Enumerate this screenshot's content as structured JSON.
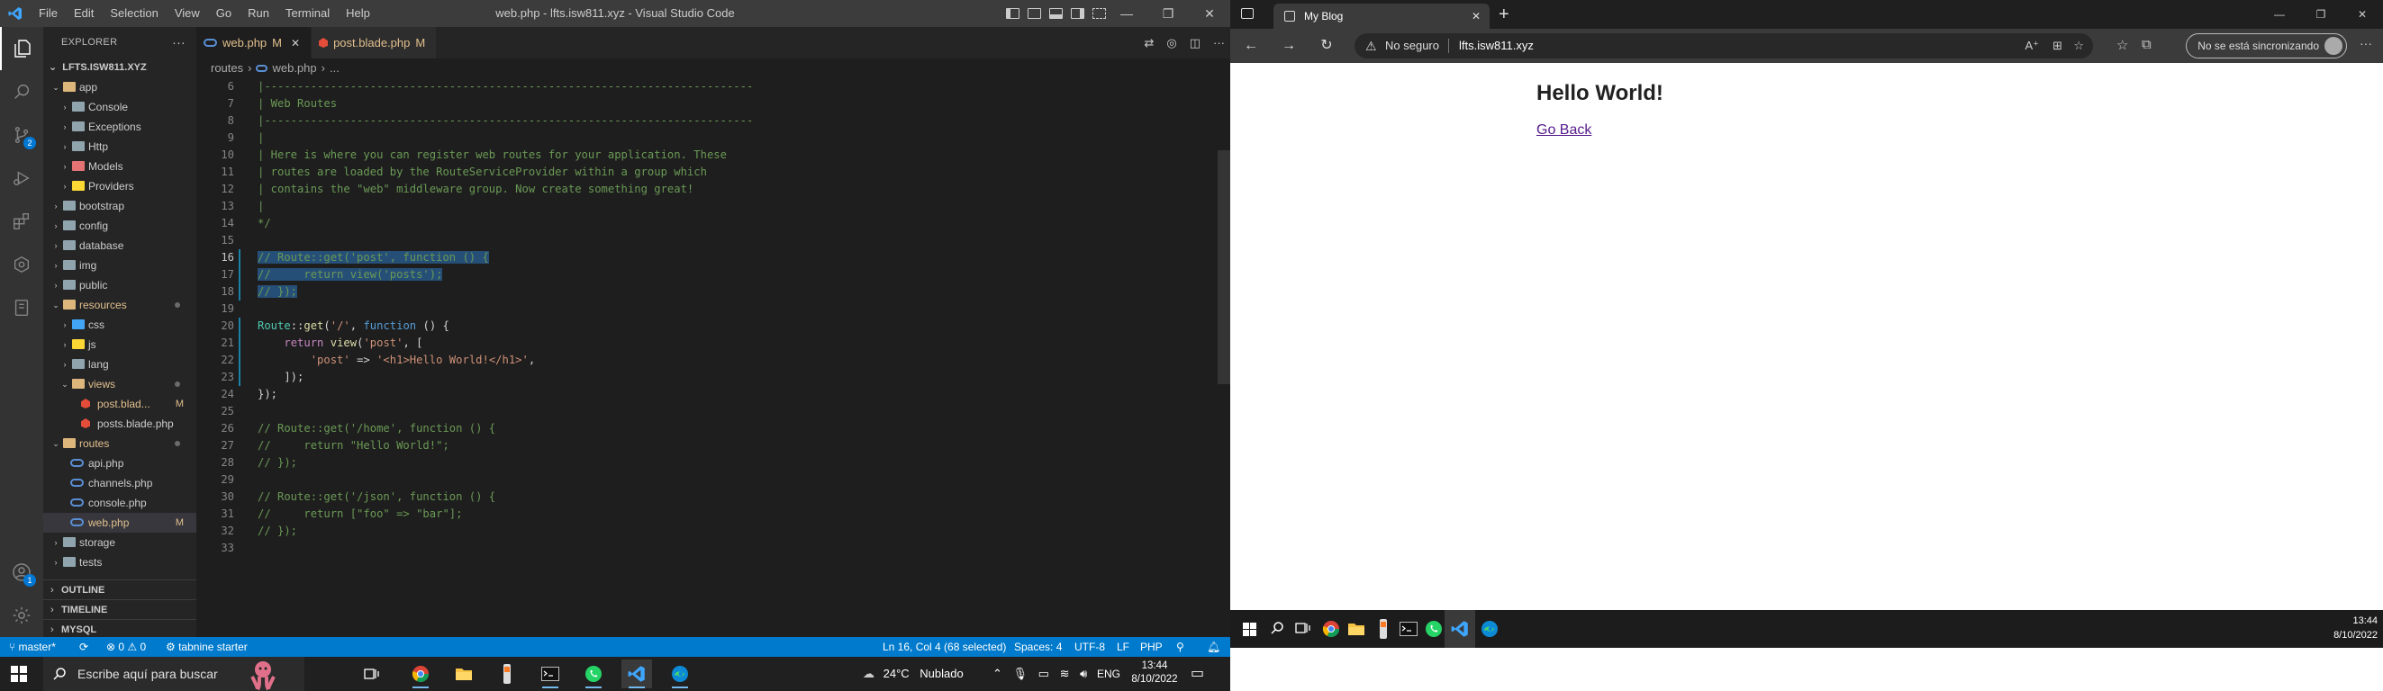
{
  "vscode": {
    "title": "web.php - lfts.isw811.xyz - Visual Studio Code",
    "menu": [
      "File",
      "Edit",
      "Selection",
      "View",
      "Go",
      "Run",
      "Terminal",
      "Help"
    ],
    "explorer_header": "EXPLORER",
    "explorer_root": "LFTS.ISW811.XYZ",
    "source_control_badge": "2",
    "accounts_badge": "1",
    "tree": [
      {
        "label": "app",
        "depth": 0,
        "type": "folder-open",
        "color": "#dcb67a"
      },
      {
        "label": "Console",
        "depth": 1,
        "type": "folder",
        "color": "#90a4ae"
      },
      {
        "label": "Exceptions",
        "depth": 1,
        "type": "folder",
        "color": "#90a4ae"
      },
      {
        "label": "Http",
        "depth": 1,
        "type": "folder",
        "color": "#90a4ae"
      },
      {
        "label": "Models",
        "depth": 1,
        "type": "folder",
        "color": "#e57373"
      },
      {
        "label": "Providers",
        "depth": 1,
        "type": "folder",
        "color": "#fdd835"
      },
      {
        "label": "bootstrap",
        "depth": 0,
        "type": "folder",
        "color": "#90a4ae"
      },
      {
        "label": "config",
        "depth": 0,
        "type": "folder",
        "color": "#90a4ae"
      },
      {
        "label": "database",
        "depth": 0,
        "type": "folder",
        "color": "#90a4ae"
      },
      {
        "label": "img",
        "depth": 0,
        "type": "folder",
        "color": "#90a4ae"
      },
      {
        "label": "public",
        "depth": 0,
        "type": "folder",
        "color": "#90a4ae"
      },
      {
        "label": "resources",
        "depth": 0,
        "type": "folder-open",
        "color": "#dcb67a",
        "modified": true
      },
      {
        "label": "css",
        "depth": 1,
        "type": "folder",
        "color": "#42a5f5"
      },
      {
        "label": "js",
        "depth": 1,
        "type": "folder",
        "color": "#fdd835"
      },
      {
        "label": "lang",
        "depth": 1,
        "type": "folder",
        "color": "#90a4ae"
      },
      {
        "label": "views",
        "depth": 1,
        "type": "folder-open",
        "color": "#dcb67a",
        "modified": true
      },
      {
        "label": "post.blad...",
        "depth": 2,
        "type": "blade",
        "mark": "M"
      },
      {
        "label": "posts.blade.php",
        "depth": 2,
        "type": "blade"
      },
      {
        "label": "routes",
        "depth": 0,
        "type": "folder-open",
        "color": "#dcb67a",
        "modified": true
      },
      {
        "label": "api.php",
        "depth": 1,
        "type": "php"
      },
      {
        "label": "channels.php",
        "depth": 1,
        "type": "php"
      },
      {
        "label": "console.php",
        "depth": 1,
        "type": "php"
      },
      {
        "label": "web.php",
        "depth": 1,
        "type": "php",
        "mark": "M",
        "selected": true
      },
      {
        "label": "storage",
        "depth": 0,
        "type": "folder",
        "color": "#90a4ae"
      },
      {
        "label": "tests",
        "depth": 0,
        "type": "folder",
        "color": "#90a4ae"
      }
    ],
    "sections": [
      "OUTLINE",
      "TIMELINE",
      "MYSQL"
    ],
    "tabs": [
      {
        "label": "web.php",
        "mark": "M",
        "active": true
      },
      {
        "label": "post.blade.php",
        "mark": "M",
        "active": false
      }
    ],
    "breadcrumb": [
      "routes",
      "web.php",
      "..."
    ],
    "code_lines": [
      {
        "n": "6",
        "html": "<span class=\"cmt\">|--------------------------------------------------------------------------</span>"
      },
      {
        "n": "7",
        "html": "<span class=\"cmt\">| Web Routes</span>"
      },
      {
        "n": "8",
        "html": "<span class=\"cmt\">|--------------------------------------------------------------------------</span>"
      },
      {
        "n": "9",
        "html": "<span class=\"cmt\">|</span>"
      },
      {
        "n": "10",
        "html": "<span class=\"cmt\">| Here is where you can register web routes for your application. These</span>"
      },
      {
        "n": "11",
        "html": "<span class=\"cmt\">| routes are loaded by the RouteServiceProvider within a group which</span>"
      },
      {
        "n": "12",
        "html": "<span class=\"cmt\">| contains the \"web\" middleware group. Now create something great!</span>"
      },
      {
        "n": "13",
        "html": "<span class=\"cmt\">|</span>"
      },
      {
        "n": "14",
        "html": "<span class=\"cmt\">*/</span>"
      },
      {
        "n": "15",
        "html": ""
      },
      {
        "n": "16",
        "html": "<span class=\"sel cmt\">// Route::get('post', function () {</span>",
        "cur": true
      },
      {
        "n": "17",
        "html": "<span class=\"sel cmt\">//     return view('posts');</span>"
      },
      {
        "n": "18",
        "html": "<span class=\"sel cmt\">// });</span>"
      },
      {
        "n": "19",
        "html": ""
      },
      {
        "n": "20",
        "html": "<span class=\"cls\">Route</span>::<span class=\"fn\">get</span>(<span class=\"str\">'/'</span>, <span class=\"kw\">function</span> () {"
      },
      {
        "n": "21",
        "html": "    <span class=\"ret\">return</span> <span class=\"fn\">view</span>(<span class=\"str\">'post'</span>, ["
      },
      {
        "n": "22",
        "html": "        <span class=\"str\">'post'</span> =&gt; <span class=\"str\">'&lt;h1&gt;Hello World!&lt;/h1&gt;'</span>,"
      },
      {
        "n": "23",
        "html": "    ]);"
      },
      {
        "n": "24",
        "html": "});"
      },
      {
        "n": "25",
        "html": ""
      },
      {
        "n": "26",
        "html": "<span class=\"cmt\">// Route::get('/home', function () {</span>"
      },
      {
        "n": "27",
        "html": "<span class=\"cmt\">//     return \"Hello World!\";</span>"
      },
      {
        "n": "28",
        "html": "<span class=\"cmt\">// });</span>"
      },
      {
        "n": "29",
        "html": ""
      },
      {
        "n": "30",
        "html": "<span class=\"cmt\">// Route::get('/json', function () {</span>"
      },
      {
        "n": "31",
        "html": "<span class=\"cmt\">//     return [\"foo\" =&gt; \"bar\"];</span>"
      },
      {
        "n": "32",
        "html": "<span class=\"cmt\">// });</span>"
      },
      {
        "n": "33",
        "html": ""
      }
    ],
    "status": {
      "branch": "master*",
      "errors": "0",
      "warnings": "0",
      "tabnine": "tabnine starter",
      "position": "Ln 16, Col 4 (68 selected)",
      "spaces": "Spaces: 4",
      "encoding": "UTF-8",
      "eol": "LF",
      "language": "PHP"
    }
  },
  "taskbar_left": {
    "search_placeholder": "Escribe aquí para buscar",
    "weather_temp": "24°C",
    "weather_text": "Nublado",
    "lang": "ENG",
    "time": "13:44",
    "date": "8/10/2022"
  },
  "browser": {
    "tab_title": "My Blog",
    "security_label": "No seguro",
    "url": "lfts.isw811.xyz",
    "sync_label": "No se está sincronizando",
    "page_heading": "Hello World!",
    "page_link": "Go Back"
  },
  "taskbar_right": {
    "time": "13:44",
    "date": "8/10/2022"
  },
  "colors": {
    "vscode_accent": "#007acc",
    "modified": "#e2c08d",
    "link_visited": "#551a8b"
  }
}
